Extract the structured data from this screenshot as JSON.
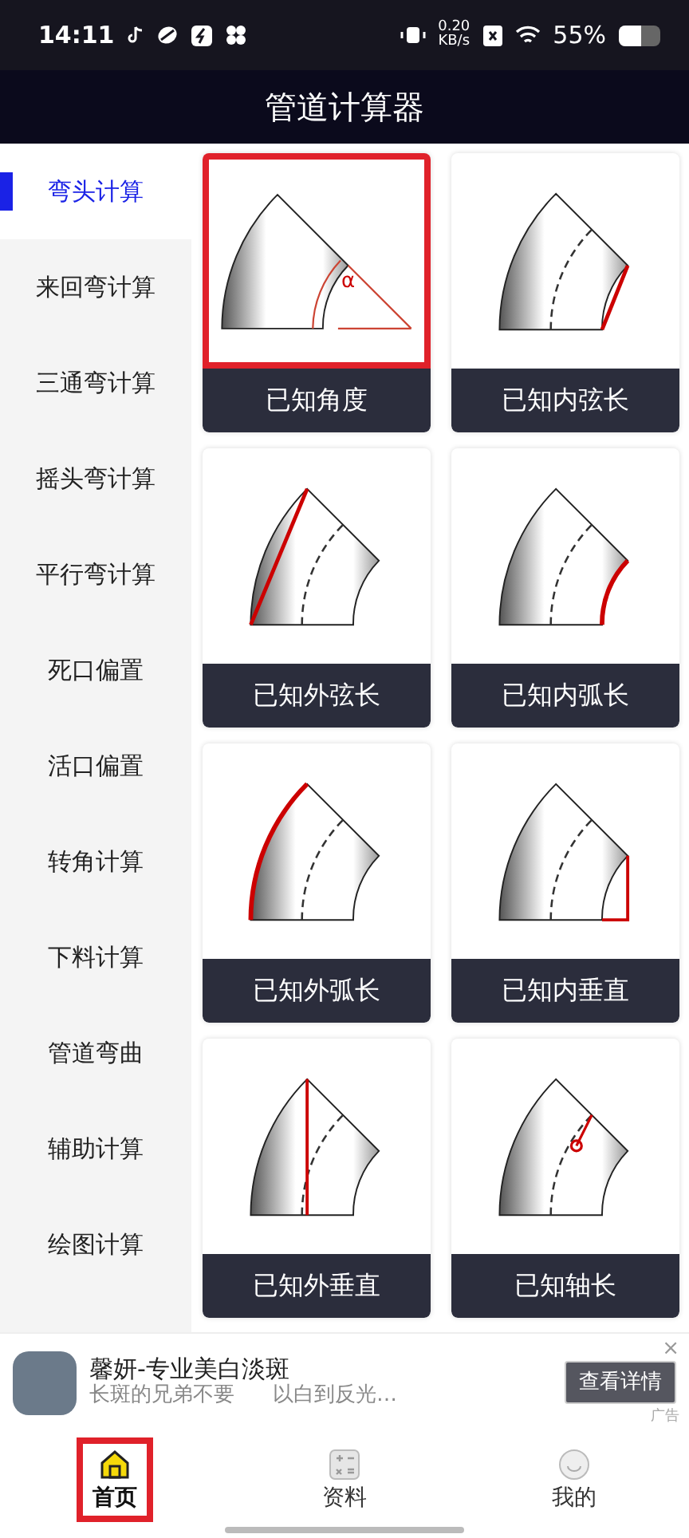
{
  "status_bar": {
    "time": "14:11",
    "net_speed": "0.20",
    "net_unit": "KB/s",
    "battery": "55%"
  },
  "title": "管道计算器",
  "sidebar": {
    "items": [
      {
        "label": "弯头计算",
        "selected": true
      },
      {
        "label": "来回弯计算",
        "selected": false
      },
      {
        "label": "三通弯计算",
        "selected": false
      },
      {
        "label": "摇头弯计算",
        "selected": false
      },
      {
        "label": "平行弯计算",
        "selected": false
      },
      {
        "label": "死口偏置",
        "selected": false
      },
      {
        "label": "活口偏置",
        "selected": false
      },
      {
        "label": "转角计算",
        "selected": false
      },
      {
        "label": "下料计算",
        "selected": false
      },
      {
        "label": "管道弯曲",
        "selected": false
      },
      {
        "label": "辅助计算",
        "selected": false
      },
      {
        "label": "绘图计算",
        "selected": false
      }
    ]
  },
  "cards": [
    {
      "label": "已知角度",
      "kind": "angle",
      "angle_symbol": "α",
      "highlighted": true
    },
    {
      "label": "已知内弦长",
      "kind": "inner-chord",
      "highlighted": false
    },
    {
      "label": "已知外弦长",
      "kind": "outer-chord",
      "highlighted": false
    },
    {
      "label": "已知内弧长",
      "kind": "inner-arc",
      "highlighted": false
    },
    {
      "label": "已知外弧长",
      "kind": "outer-arc",
      "highlighted": false
    },
    {
      "label": "已知内垂直",
      "kind": "inner-vertical",
      "highlighted": false
    },
    {
      "label": "已知外垂直",
      "kind": "outer-vertical",
      "highlighted": false
    },
    {
      "label": "已知轴长",
      "kind": "axis",
      "highlighted": false
    }
  ],
  "ad": {
    "title": "馨妍-专业美白淡斑",
    "text_parts": [
      "长斑的兄弟不要",
      "以白到反光…"
    ],
    "button": "查看详情",
    "close": "×",
    "tag": "广告"
  },
  "bottom_nav": [
    {
      "label": "首页",
      "selected": true,
      "highlighted": true
    },
    {
      "label": "资料",
      "selected": false,
      "highlighted": false
    },
    {
      "label": "我的",
      "selected": false,
      "highlighted": false
    }
  ]
}
